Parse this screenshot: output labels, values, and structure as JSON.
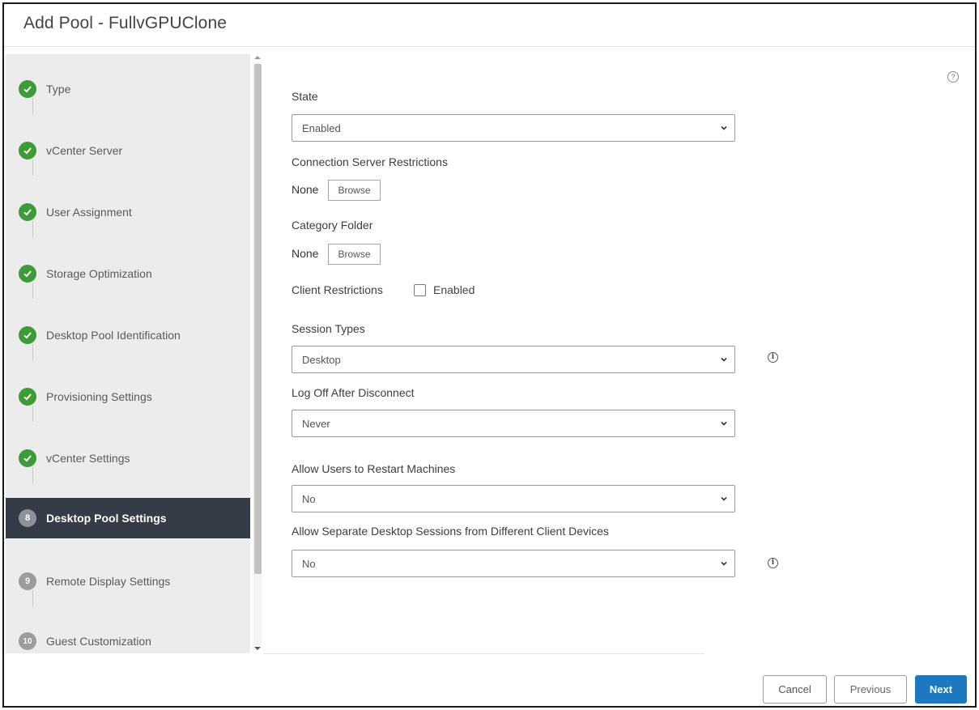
{
  "dialog": {
    "title": "Add Pool - FullvGPUClone",
    "help_icon": "question-circle-icon"
  },
  "wizard_steps": [
    {
      "number": "1",
      "label": "Type",
      "status": "complete"
    },
    {
      "number": "2",
      "label": "vCenter Server",
      "status": "complete"
    },
    {
      "number": "3",
      "label": "User Assignment",
      "status": "complete"
    },
    {
      "number": "4",
      "label": "Storage Optimization",
      "status": "complete"
    },
    {
      "number": "5",
      "label": "Desktop Pool Identification",
      "status": "complete"
    },
    {
      "number": "6",
      "label": "Provisioning Settings",
      "status": "complete"
    },
    {
      "number": "7",
      "label": "vCenter Settings",
      "status": "complete"
    },
    {
      "number": "8",
      "label": "Desktop Pool Settings",
      "status": "active"
    },
    {
      "number": "9",
      "label": "Remote Display Settings",
      "status": "pending"
    },
    {
      "number": "10",
      "label": "Guest Customization",
      "status": "pending"
    }
  ],
  "form": {
    "state": {
      "label": "State",
      "value": "Enabled"
    },
    "connection_server": {
      "label": "Connection Server Restrictions",
      "value": "None",
      "button": "Browse"
    },
    "category_folder": {
      "label": "Category Folder",
      "value": "None",
      "button": "Browse"
    },
    "client_restrictions": {
      "label": "Client Restrictions",
      "checkbox_label": "Enabled",
      "checked": false
    },
    "session_types": {
      "label": "Session Types",
      "value": "Desktop"
    },
    "log_off": {
      "label": "Log Off After Disconnect",
      "value": "Never"
    },
    "allow_restart": {
      "label": "Allow Users to Restart Machines",
      "value": "No"
    },
    "separate_sessions": {
      "label": "Allow Separate Desktop Sessions from Different Client Devices",
      "value": "No"
    }
  },
  "footer": {
    "cancel": "Cancel",
    "previous": "Previous",
    "next": "Next"
  },
  "colors": {
    "complete": "#3f9a3a",
    "active_bg": "#363c47",
    "primary": "#1e78c0"
  }
}
